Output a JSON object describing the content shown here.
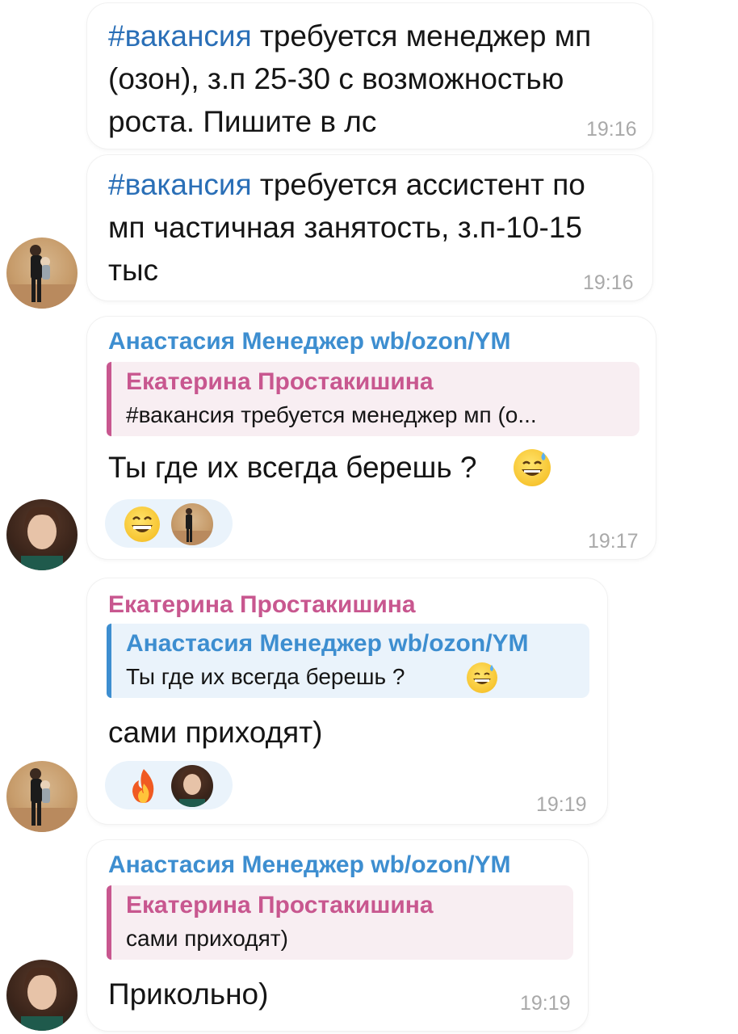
{
  "messages": [
    {
      "hashtag": "#вакансия",
      "text_l1": " требуется менеджер мп",
      "text_l2": "(озон), з.п 25-30 с возможностью",
      "text_l3": "роста. Пишите в лс",
      "time": "19:16"
    },
    {
      "hashtag": "#вакансия",
      "text_l1": " требуется ассистент по",
      "text_l2": "мп частичная занятость, з.п-10-15",
      "text_l3": "тыс",
      "time": "19:16"
    },
    {
      "author": "Анастасия Менеджер wb/ozon/YM",
      "reply_author": "Екатерина Простакишина",
      "reply_text": "#вакансия требуется менеджер мп (о...",
      "text": "Ты где их всегда берешь ?",
      "time": "19:17"
    },
    {
      "author": "Екатерина Простакишина",
      "reply_author": "Анастасия Менеджер wb/ozon/YM",
      "reply_text": "Ты где их всегда берешь ?",
      "text": "сами приходят)",
      "time": "19:19"
    },
    {
      "author": "Анастасия Менеджер wb/ozon/YM",
      "reply_author": "Екатерина Простакишина",
      "reply_text": "сами приходят)",
      "text": "Прикольно)",
      "time": "19:19"
    }
  ],
  "icons": {
    "avatar_a": "avatar-photo-woman-with-child",
    "avatar_b": "avatar-photo-woman-portrait",
    "sweat_smile": "grinning-face-with-sweat-emoji",
    "grin": "beaming-face-emoji",
    "fire": "fire-emoji"
  },
  "colors": {
    "link": "#3d8ed0",
    "pink_name": "#c8578f",
    "hashtag": "#2a6fb7",
    "time": "#a9a9a9",
    "reaction_bg": "#eaf3fb"
  }
}
